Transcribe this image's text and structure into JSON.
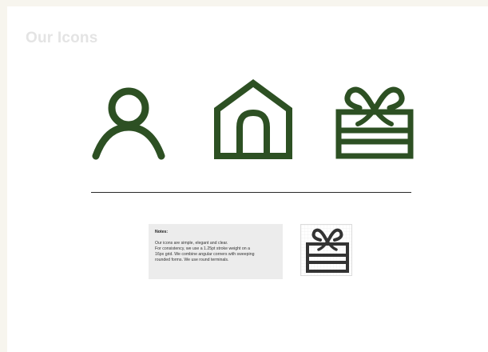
{
  "page": {
    "title": "Our Icons"
  },
  "icons": [
    {
      "name": "person-icon"
    },
    {
      "name": "home-icon"
    },
    {
      "name": "gift-icon"
    }
  ],
  "colors": {
    "icon_stroke": "#2d5023",
    "title": "#e4e4e4",
    "notes_background": "#ececec",
    "preview_icon": "#333333"
  },
  "notes": {
    "heading": "Notes:",
    "line1": "Our icons are simple, elegant and clear.",
    "line2": "For consistency, we use a 1.25pt stroke weight on a",
    "line3": "16px grid. We combine angular corners with sweeping",
    "line4": "rounded forms. We use round terminals."
  },
  "preview": {
    "icon": "gift-icon"
  }
}
